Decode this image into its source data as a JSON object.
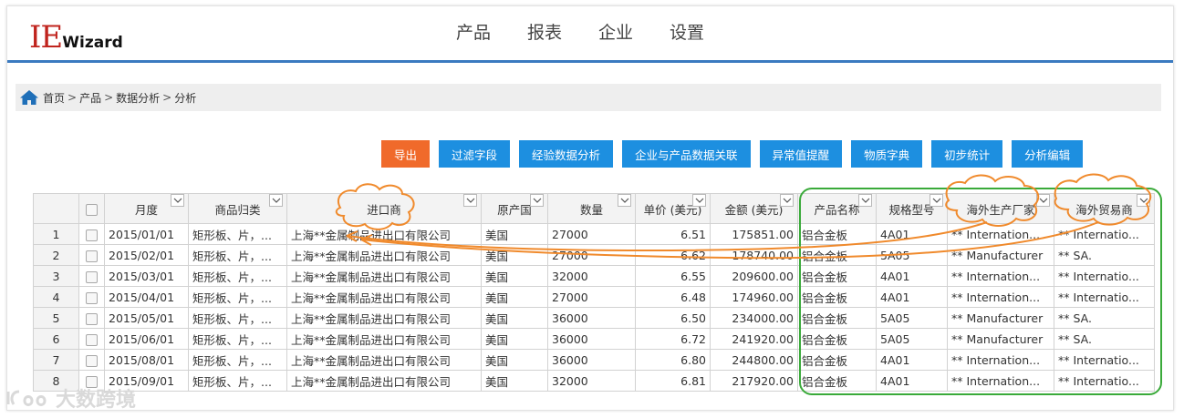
{
  "logo": {
    "ie": "IE",
    "wizard": "Wizard"
  },
  "nav": [
    "产品",
    "报表",
    "企业",
    "设置"
  ],
  "breadcrumb": [
    "首页",
    "产品",
    "数据分析",
    "分析"
  ],
  "toolbar": [
    "导出",
    "过滤字段",
    "经验数据分析",
    "企业与产品数据关联",
    "异常值提醒",
    "物质字典",
    "初步统计",
    "分析编辑"
  ],
  "table": {
    "headers": [
      "月度",
      "商品归类",
      "进口商",
      "原产国",
      "数量",
      "单价 (美元)",
      "金额 (美元)",
      "产品名称",
      "规格型号",
      "海外生产厂家",
      "海外贸易商"
    ],
    "rows": [
      [
        "1",
        "2015/01/01",
        "矩形板、片，...",
        "上海**金属制品进出口有限公司",
        "美国",
        "27000",
        "6.51",
        "175851.00",
        "铝合金板",
        "4A01",
        "** Internation...",
        "** Internatio..."
      ],
      [
        "2",
        "2015/02/01",
        "矩形板、片，...",
        "上海**金属制品进出口有限公司",
        "美国",
        "27000",
        "6.62",
        "178740.00",
        "铝合金板",
        "5A05",
        "** Manufacturer",
        "** SA."
      ],
      [
        "3",
        "2015/03/01",
        "矩形板、片，...",
        "上海**金属制品进出口有限公司",
        "美国",
        "32000",
        "6.55",
        "209600.00",
        "铝合金板",
        "4A01",
        "** Internation...",
        "** Internatio..."
      ],
      [
        "4",
        "2015/04/01",
        "矩形板、片，...",
        "上海**金属制品进出口有限公司",
        "美国",
        "27000",
        "6.48",
        "174960.00",
        "铝合金板",
        "4A01",
        "** Internation...",
        "** Internatio..."
      ],
      [
        "5",
        "2015/05/01",
        "矩形板、片，...",
        "上海**金属制品进出口有限公司",
        "美国",
        "36000",
        "6.50",
        "234000.00",
        "铝合金板",
        "5A05",
        "** Manufacturer",
        "** SA."
      ],
      [
        "6",
        "2015/06/01",
        "矩形板、片，...",
        "上海**金属制品进出口有限公司",
        "美国",
        "36000",
        "6.72",
        "241920.00",
        "铝合金板",
        "5A05",
        "** Manufacturer",
        "** SA."
      ],
      [
        "7",
        "2015/08/01",
        "矩形板、片，...",
        "上海**金属制品进出口有限公司",
        "美国",
        "36000",
        "6.80",
        "244800.00",
        "铝合金板",
        "4A01",
        "** Internation...",
        "** Internatio..."
      ],
      [
        "8",
        "2015/09/01",
        "矩形板、片，...",
        "上海**金属制品进出口有限公司",
        "美国",
        "32000",
        "6.81",
        "217920.00",
        "铝合金板",
        "4A01",
        "** Internation...",
        "** Internatio..."
      ]
    ]
  },
  "watermark": "大数跨境",
  "colors": {
    "accent_blue": "#1d8fe0",
    "export_orange": "#f06a2b",
    "logo_red": "#c0241e",
    "annotation_orange": "#f08a2c",
    "annotation_green": "#3aaa3a"
  }
}
